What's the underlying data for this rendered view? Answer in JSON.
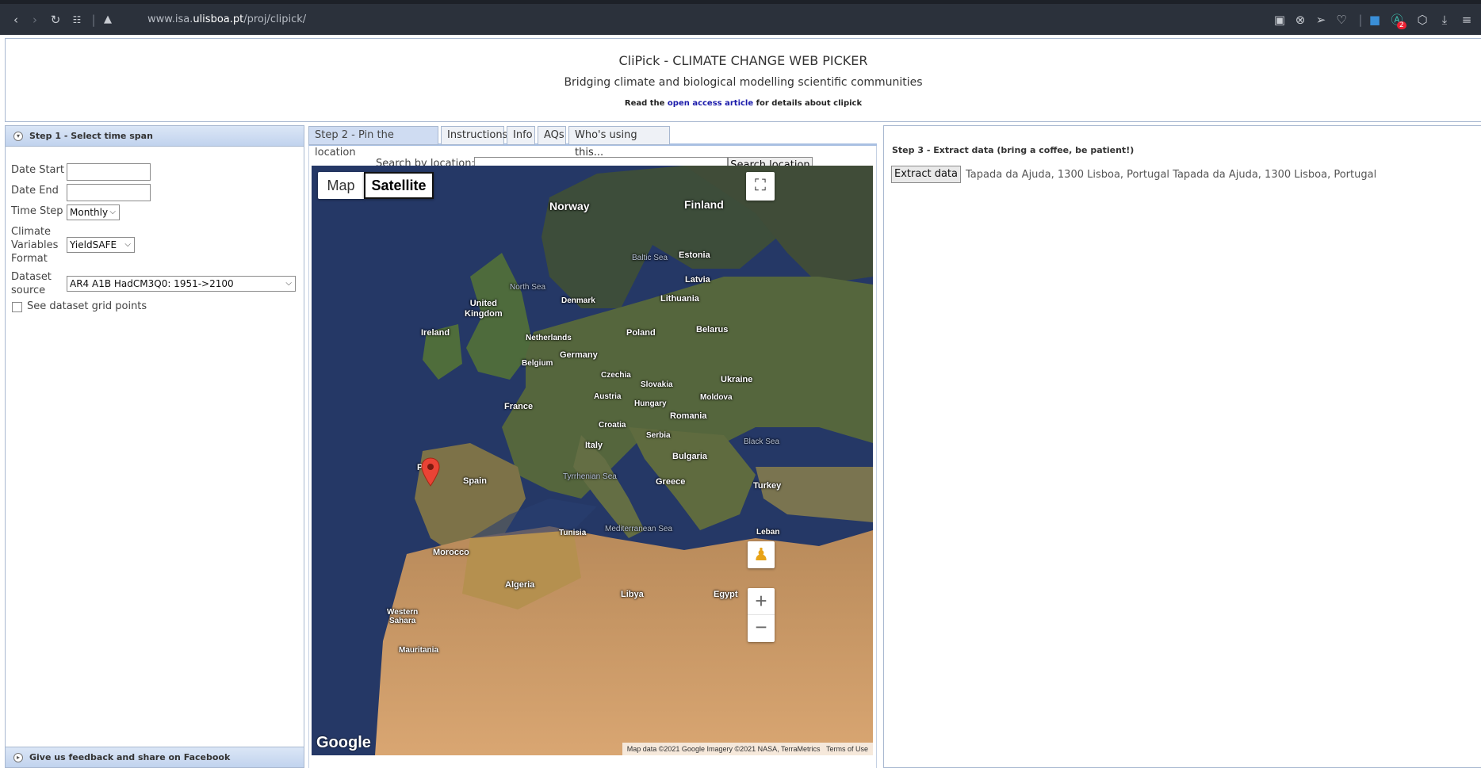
{
  "browser": {
    "url_prefix": "www.isa.",
    "url_domain": "ulisboa.pt",
    "url_path": "/proj/clipick/",
    "notification_count": "2"
  },
  "header": {
    "title": "CliPick - CLIMATE CHANGE WEB PICKER",
    "subtitle": "Bridging climate and biological modelling scientific communities",
    "read_prefix": "Read the",
    "read_link": "open access article",
    "read_suffix": "for details about clipick"
  },
  "step1": {
    "title": "Step 1 - Select time span",
    "date_start_label": "Date Start",
    "date_end_label": "Date End",
    "time_step_label": "Time Step",
    "time_step_value": "Monthly",
    "climate_label_1": "Climate",
    "climate_label_2": "Variables",
    "climate_label_3": "Format",
    "climate_value": "YieldSAFE",
    "dataset_label_1": "Dataset",
    "dataset_label_2": "source",
    "dataset_value": "AR4 A1B HadCM3Q0: 1951->2100",
    "grid_points_label": "See dataset grid points",
    "feedback": "Give us feedback and share on Facebook"
  },
  "step2": {
    "tabs": [
      "Step 2 - Pin the location",
      "Instructions",
      "Info",
      "AQs",
      "Who's using this..."
    ],
    "search_label": "Search by location:",
    "search_value": "",
    "search_button": "Search location",
    "map_type_map": "Map",
    "map_type_satellite": "Satellite",
    "google": "Google",
    "map_footer_data": "Map data ©2021 Google Imagery ©2021 NASA, TerraMetrics",
    "map_footer_terms": "Terms of Use",
    "labels": {
      "norway": "Norway",
      "finland": "Finland",
      "baltic": "Baltic Sea",
      "estonia": "Estonia",
      "latvia": "Latvia",
      "north_sea": "North Sea",
      "denmark": "Denmark",
      "lithuania": "Lithuania",
      "uk1": "United",
      "uk2": "Kingdom",
      "ireland": "Ireland",
      "netherlands": "Netherlands",
      "poland": "Poland",
      "belarus": "Belarus",
      "germany": "Germany",
      "belgium": "Belgium",
      "czechia": "Czechia",
      "ukraine": "Ukraine",
      "slovakia": "Slovakia",
      "austria": "Austria",
      "moldova": "Moldova",
      "hungary": "Hungary",
      "france": "France",
      "romania": "Romania",
      "croatia": "Croatia",
      "serbia": "Serbia",
      "italy": "Italy",
      "black_sea": "Black Sea",
      "bulgaria": "Bulgaria",
      "portugal": "P    gal",
      "spain": "Spain",
      "tyrrhenian": "Tyrrhenian Sea",
      "greece": "Greece",
      "turkey": "Turkey",
      "tunisia": "Tunisia",
      "med": "Mediterranean Sea",
      "lebanon": "Leban",
      "morocco": "Morocco",
      "algeria": "Algeria",
      "libya": "Libya",
      "egypt": "Egypt",
      "ws1": "Western",
      "ws2": "Sahara",
      "mauritania": "Mauritania"
    }
  },
  "step3": {
    "title": "Step 3 - Extract data (bring a coffee, be patient!)",
    "extract_button": "Extract data",
    "address": "Tapada da Ajuda, 1300 Lisboa, Portugal Tapada da Ajuda, 1300 Lisboa, Portugal"
  }
}
